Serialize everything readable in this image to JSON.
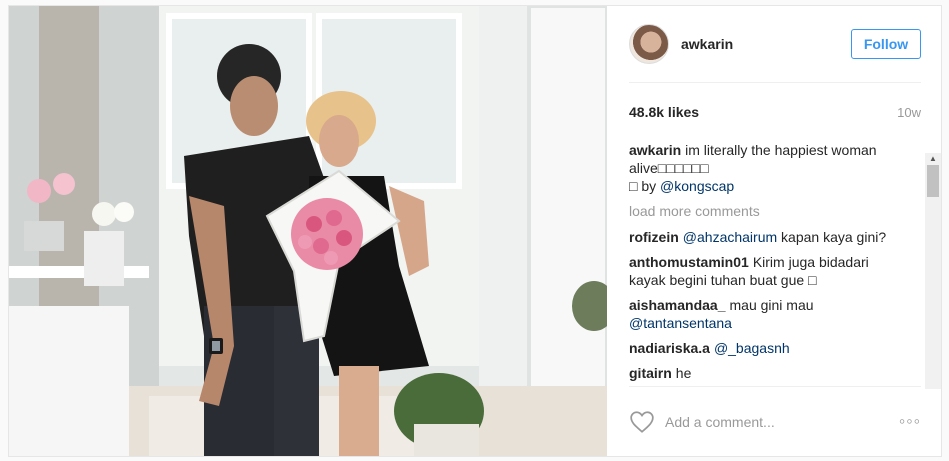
{
  "post": {
    "author": "awkarin",
    "follow_label": "Follow",
    "likes": "48.8k likes",
    "time_ago": "10w",
    "caption": {
      "user": "awkarin",
      "text_line1": "im literally the happiest woman",
      "text_line2": "alive□□□□□□",
      "text_line3_prefix": "□ by ",
      "mention": "@kongscap"
    },
    "load_more_label": "load more comments",
    "comments": [
      {
        "user": "rofizein",
        "mention": "@ahzachairum",
        "text": " kapan kaya gini?"
      },
      {
        "user": "anthomustamin01",
        "mention": "",
        "text": "Kirim juga bidadari kayak begini tuhan buat gue □"
      },
      {
        "user": "aishamandaa_",
        "mention": "@tantansentana",
        "text": "mau gini mau "
      },
      {
        "user": "nadiariska.a",
        "mention": "@_bagasnh",
        "text": ""
      },
      {
        "user": "gitairn",
        "mention": "",
        "text": "he"
      }
    ],
    "add_comment_placeholder": "Add a comment...",
    "more_options": "◦◦◦"
  },
  "icons": {
    "heart": "heart-outline-icon",
    "more": "more-options-icon"
  },
  "colors": {
    "accent": "#3897f0",
    "mention": "#003569",
    "muted": "#999999"
  }
}
